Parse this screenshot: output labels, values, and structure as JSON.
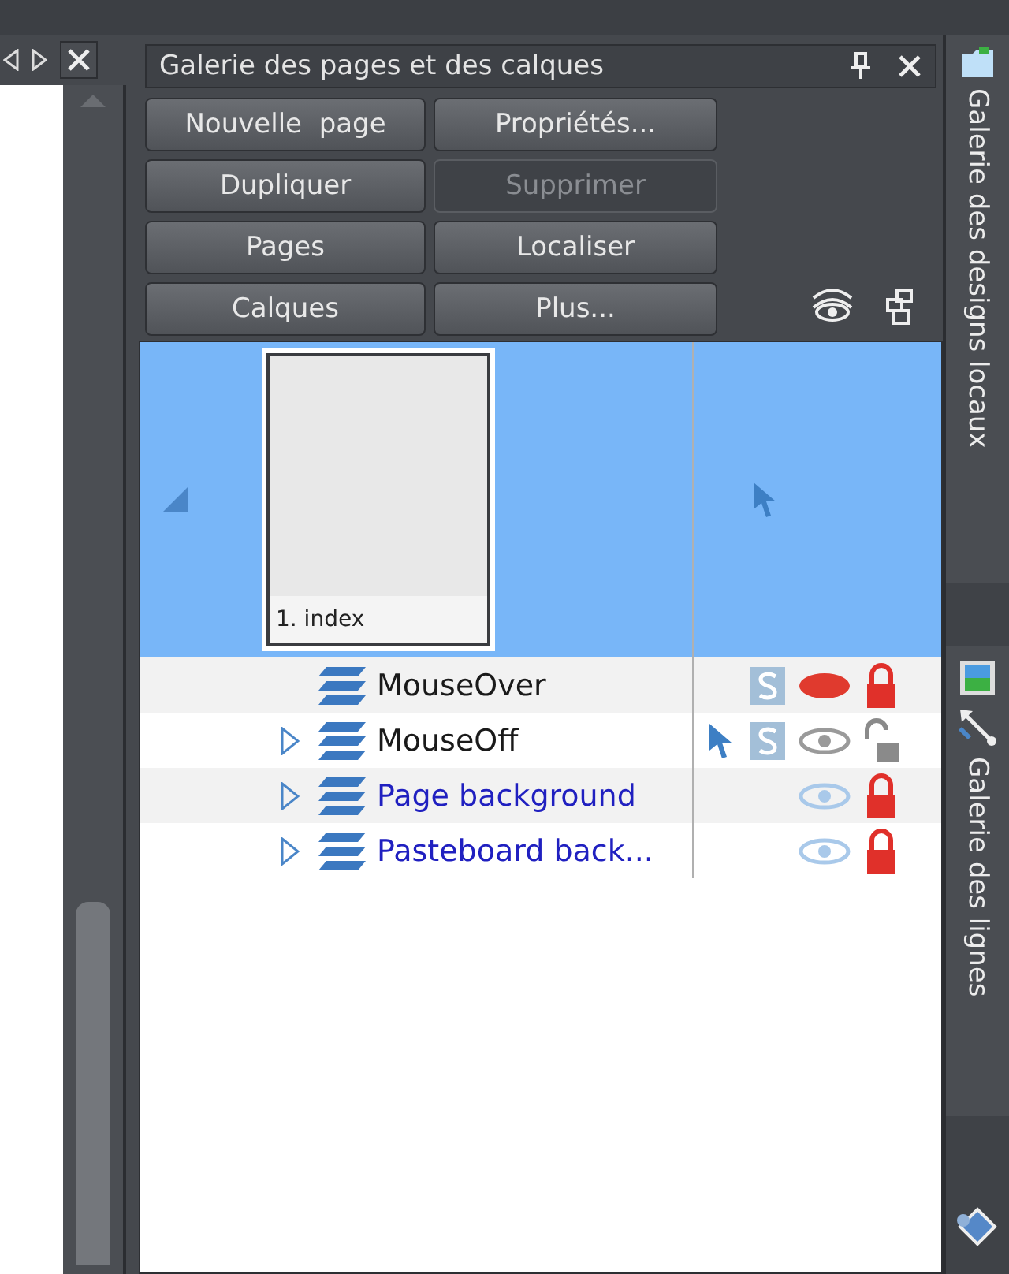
{
  "panel": {
    "title": "Galerie des pages et des calques"
  },
  "buttons": [
    {
      "label": "Nouvelle  page",
      "disabled": false
    },
    {
      "label": "Propriétés...",
      "disabled": false
    },
    {
      "label": "Dupliquer",
      "disabled": false
    },
    {
      "label": "Supprimer",
      "disabled": true
    },
    {
      "label": "Pages",
      "disabled": false
    },
    {
      "label": "Localiser",
      "disabled": false
    },
    {
      "label": "Calques",
      "disabled": false
    },
    {
      "label": "Plus...",
      "disabled": false
    }
  ],
  "page": {
    "label": "1. index",
    "selected": true
  },
  "layers": [
    {
      "name": "MouseOver",
      "expandable": false,
      "color": "#1a1a1a",
      "pointer": false,
      "sticky": true,
      "eye_open": false,
      "eye_dimmed": false,
      "locked": true
    },
    {
      "name": "MouseOff",
      "expandable": true,
      "color": "#1a1a1a",
      "pointer": true,
      "sticky": true,
      "eye_open": true,
      "eye_dimmed": false,
      "locked": false
    },
    {
      "name": "Page background",
      "expandable": true,
      "color": "#2020c0",
      "pointer": false,
      "sticky": false,
      "eye_open": true,
      "eye_dimmed": true,
      "locked": true
    },
    {
      "name": "Pasteboard back...",
      "expandable": true,
      "color": "#2020c0",
      "pointer": false,
      "sticky": false,
      "eye_open": true,
      "eye_dimmed": true,
      "locked": true
    }
  ],
  "side_tabs": [
    {
      "label": "Galerie des designs locaux"
    },
    {
      "label": "Galerie des lignes"
    }
  ]
}
